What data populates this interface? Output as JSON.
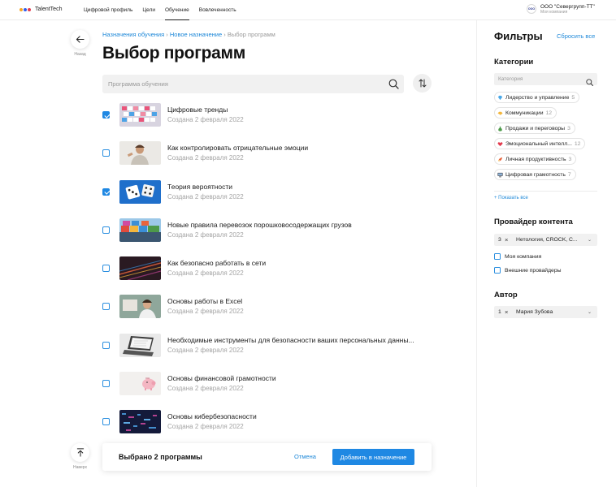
{
  "header": {
    "logo_text": "TalentTech",
    "logo_dot_colors": [
      "#f6a623",
      "#2f5bea",
      "#e23b4e"
    ],
    "nav": [
      {
        "label": "Цифровой профиль",
        "active": false
      },
      {
        "label": "Цели",
        "active": false
      },
      {
        "label": "Обучение",
        "active": true
      },
      {
        "label": "Вовлеченность",
        "active": false
      }
    ],
    "company_logo_text": "ООО",
    "company_name": "ООО \"Севергрупп-ТТ\"",
    "company_sub": "Моя компания"
  },
  "side_nav": {
    "back_label": "Назад",
    "top_label": "Наверх"
  },
  "breadcrumb": {
    "items": [
      "Назначения обучения",
      "Новое назначение",
      "Выбор программ"
    ],
    "separator": "›"
  },
  "page_title": "Выбор программ",
  "search": {
    "placeholder": "Программа обучения",
    "value": ""
  },
  "programs": [
    {
      "title": "Цифровые тренды",
      "date": "Создана 2 февраля 2022",
      "checked": true
    },
    {
      "title": "Как контролировать отрицательные эмоции",
      "date": "Создана 2 февраля 2022",
      "checked": false
    },
    {
      "title": "Теория вероятности",
      "date": "Создана 2 февраля 2022",
      "checked": true
    },
    {
      "title": "Новые правила перевозок порошковосодержащих грузов",
      "date": "Создана 2 февраля 2022",
      "checked": false
    },
    {
      "title": "Как безопасно работать в сети",
      "date": "Создана 2 февраля 2022",
      "checked": false
    },
    {
      "title": "Основы работы в Excel",
      "date": "Создана 2 февраля 2022",
      "checked": false
    },
    {
      "title": "Необходимые инструменты для безопасности ваших персональных данны...",
      "date": "Создана 2 февраля 2022",
      "checked": false
    },
    {
      "title": "Основы финансовой грамотности",
      "date": "Создана 2 февраля 2022",
      "checked": false
    },
    {
      "title": "Основы кибербезопасности",
      "date": "Создана 2 февраля 2022",
      "checked": false
    }
  ],
  "bottom_bar": {
    "selected_text": "Выбрано 2 программы",
    "cancel_label": "Отмена",
    "add_label": "Добавить в назначение"
  },
  "filters": {
    "title": "Фильтры",
    "reset_label": "Сбросить все",
    "categories_title": "Категории",
    "category_search_placeholder": "Категория",
    "categories": [
      {
        "label": "Лидерство и управление",
        "count": "5",
        "icon": "diamond-icon",
        "color": "#4aa8e8"
      },
      {
        "label": "Коммуникации",
        "count": "12",
        "icon": "handshake-icon",
        "color": "#f3b63c"
      },
      {
        "label": "Продажи и переговоры",
        "count": "3",
        "icon": "money-bag-icon",
        "color": "#4d9a4a"
      },
      {
        "label": "Эмоциональный интелл...",
        "count": "12",
        "icon": "heart-icon",
        "color": "#e23b4e"
      },
      {
        "label": "Личная продуктивность",
        "count": "3",
        "icon": "rocket-icon",
        "color": "#e8643c"
      },
      {
        "label": "Цифровая грамотность",
        "count": "7",
        "icon": "computer-icon",
        "color": "#3a3f4a"
      }
    ],
    "show_all_label": "+ Показать все",
    "provider_title": "Провайдер контента",
    "provider_select": {
      "count": "3",
      "value": "Нетология, CROCK, С..."
    },
    "provider_options": [
      {
        "label": "Моя компания",
        "checked": false
      },
      {
        "label": "Внешние провайдеры",
        "checked": false
      }
    ],
    "author_title": "Автор",
    "author_select": {
      "count": "1",
      "value": "Мария Зубова"
    }
  },
  "colors": {
    "accent": "#1f88e3",
    "link": "#1e88d8",
    "muted": "#a4a4a4"
  }
}
